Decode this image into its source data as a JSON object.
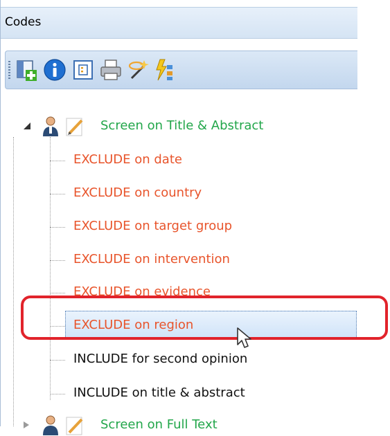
{
  "panel": {
    "title": "Codes"
  },
  "toolbar": {
    "buttons": [
      {
        "name": "add-code-icon"
      },
      {
        "name": "info-icon"
      },
      {
        "name": "properties-icon"
      },
      {
        "name": "print-icon"
      },
      {
        "name": "magic-wand-icon"
      },
      {
        "name": "auto-code-icon"
      }
    ]
  },
  "tree": {
    "root1": {
      "label": "Screen on Title & Abstract",
      "color": "#22a64a"
    },
    "children": [
      {
        "label": "EXCLUDE on date",
        "color": "#e8542b"
      },
      {
        "label": "EXCLUDE on country",
        "color": "#e8542b"
      },
      {
        "label": "EXCLUDE on target group",
        "color": "#e8542b"
      },
      {
        "label": "EXCLUDE on intervention",
        "color": "#e8542b"
      },
      {
        "label": "EXCLUDE on evidence",
        "color": "#e8542b"
      },
      {
        "label": "EXCLUDE on region",
        "color": "#e8542b",
        "selected": true
      },
      {
        "label": "INCLUDE for second opinion",
        "color": "#111111"
      },
      {
        "label": "INCLUDE on title & abstract",
        "color": "#111111"
      }
    ],
    "root2": {
      "label": "Screen on Full Text",
      "color": "#22a64a"
    }
  }
}
